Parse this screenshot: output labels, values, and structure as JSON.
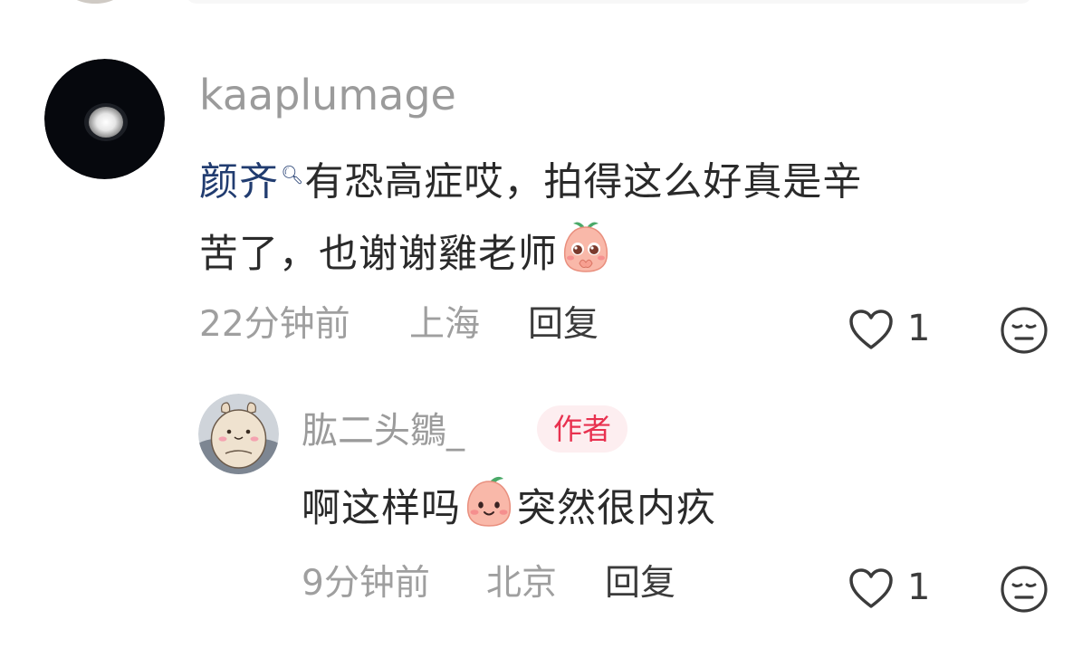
{
  "comments": [
    {
      "username": "kaaplumage",
      "mention": "颜齐",
      "text_line1": "有恐高症哎，拍得这么好真是辛",
      "text_line2": "苦了，也谢谢雞老师",
      "emoji": "pleading-face-emoji",
      "time": "22分钟前",
      "location": "上海",
      "reply_label": "回复",
      "like_count": "1"
    }
  ],
  "reply": {
    "username": "肱二头鶵_",
    "badge": "作者",
    "text_before_emoji": "啊这样吗",
    "emoji": "smiling-face-emoji",
    "text_after_emoji": "突然很内疚",
    "time": "9分钟前",
    "location": "北京",
    "reply_label": "回复",
    "like_count": "1"
  },
  "icons": {
    "like": "heart-outline-icon",
    "dislike": "meh-face-icon"
  },
  "colors": {
    "mention": "#213c70",
    "badge_text": "#e8314f",
    "badge_bg": "#fdeef0",
    "meta_text": "#9f9f9f"
  }
}
